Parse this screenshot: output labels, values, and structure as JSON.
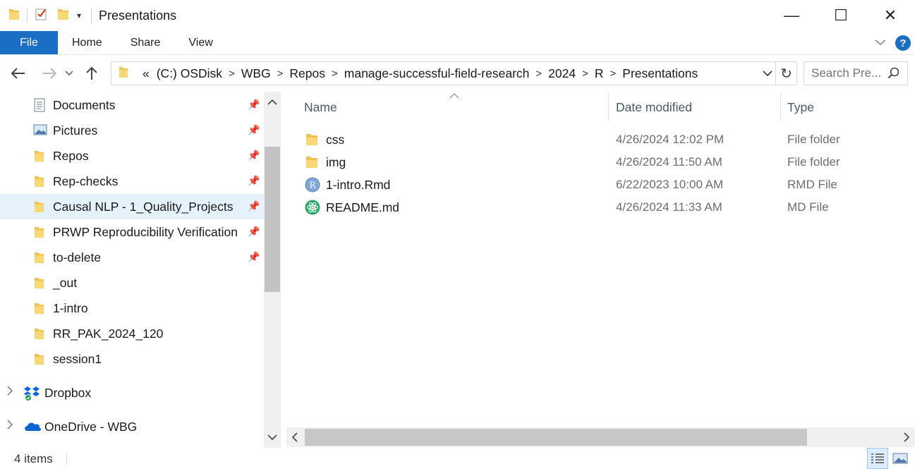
{
  "window": {
    "title": "Presentations",
    "controls": {
      "minimize": "—",
      "maximize": "☐",
      "close": "✕"
    }
  },
  "ribbon": {
    "tabs": [
      {
        "label": "File"
      },
      {
        "label": "Home"
      },
      {
        "label": "Share"
      },
      {
        "label": "View"
      }
    ],
    "help_label": "?"
  },
  "address": {
    "overflow": "«",
    "breadcrumbs": [
      "(C:) OSDisk",
      "WBG",
      "Repos",
      "manage-successful-field-research",
      "2024",
      "R",
      "Presentations"
    ]
  },
  "search": {
    "placeholder": "Search Pre..."
  },
  "navpane": {
    "quick_access": [
      {
        "label": "Documents",
        "icon": "documents-icon",
        "pinned": true
      },
      {
        "label": "Pictures",
        "icon": "pictures-icon",
        "pinned": true
      },
      {
        "label": "Repos",
        "icon": "folder-icon",
        "pinned": true
      },
      {
        "label": "Rep-checks",
        "icon": "folder-icon",
        "pinned": true
      },
      {
        "label": "Causal NLP - 1_Quality_Projects",
        "icon": "folder-icon",
        "pinned": true,
        "selected": true
      },
      {
        "label": "PRWP Reproducibility Verification",
        "icon": "folder-icon",
        "pinned": true
      },
      {
        "label": "to-delete",
        "icon": "folder-icon",
        "pinned": true
      },
      {
        "label": "_out",
        "icon": "folder-icon",
        "pinned": false
      },
      {
        "label": "1-intro",
        "icon": "folder-icon",
        "pinned": false
      },
      {
        "label": "RR_PAK_2024_120",
        "icon": "folder-icon",
        "pinned": false
      },
      {
        "label": "session1",
        "icon": "folder-icon",
        "pinned": false
      }
    ],
    "roots": [
      {
        "label": "Dropbox",
        "icon": "dropbox-icon"
      },
      {
        "label": "OneDrive - WBG",
        "icon": "onedrive-icon"
      }
    ]
  },
  "filelist": {
    "columns": {
      "name": "Name",
      "date": "Date modified",
      "type": "Type"
    },
    "rows": [
      {
        "name": "css",
        "date": "4/26/2024 12:02 PM",
        "type": "File folder",
        "icon": "folder-icon"
      },
      {
        "name": "img",
        "date": "4/26/2024 11:50 AM",
        "type": "File folder",
        "icon": "folder-icon"
      },
      {
        "name": "1-intro.Rmd",
        "date": "6/22/2023 10:00 AM",
        "type": "RMD File",
        "icon": "r-file-icon"
      },
      {
        "name": "README.md",
        "date": "4/26/2024 11:33 AM",
        "type": "MD File",
        "icon": "atom-icon"
      }
    ]
  },
  "status": {
    "count": "4 items"
  },
  "colors": {
    "accent": "#1a6fc4",
    "selection": "#e5f1fb",
    "folder": "#f2c14e"
  }
}
